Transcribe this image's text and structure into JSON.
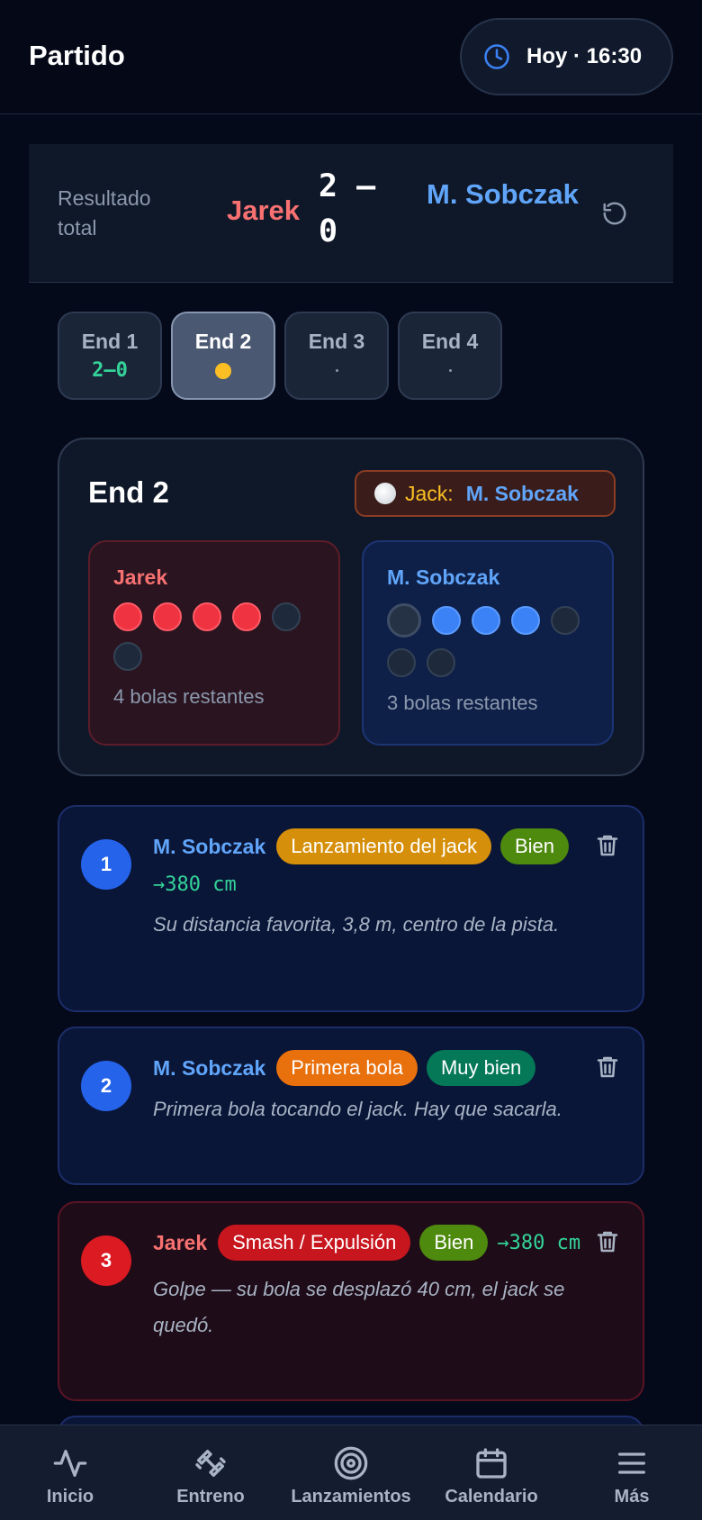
{
  "header": {
    "title": "Partido",
    "time": "Hoy · 16:30",
    "time_icon": "clock-icon"
  },
  "score": {
    "label": "Resultado total",
    "player_a": "Jarek",
    "value": "2 — 0",
    "player_b": "M. Sobczak",
    "reset_icon": "reset-icon"
  },
  "ends": [
    {
      "label": "End 1",
      "sub": "2–0",
      "state": "done"
    },
    {
      "label": "End 2",
      "sub": "",
      "state": "active"
    },
    {
      "label": "End 3",
      "sub": "",
      "state": "pending"
    },
    {
      "label": "End 4",
      "sub": "",
      "state": "pending"
    }
  ],
  "end_panel": {
    "title": "End 2",
    "jack_label": "Jack:",
    "jack_player": "M. Sobczak",
    "players": [
      {
        "name": "Jarek",
        "remaining_text": "4 bolas restantes",
        "balls_remaining": 4,
        "balls_total": 6
      },
      {
        "name": "M. Sobczak",
        "remaining_text": "3 bolas restantes",
        "balls_remaining": 3,
        "balls_total": 6
      }
    ]
  },
  "events": [
    {
      "num": "1",
      "player": "M. Sobczak",
      "type": "Lanzamiento del jack",
      "rating": "Bien",
      "distance": "→380 cm",
      "note": "Su distancia favorita, 3,8 m, centro de la pista."
    },
    {
      "num": "2",
      "player": "M. Sobczak",
      "type": "Primera bola",
      "rating": "Muy bien",
      "distance": "",
      "note": "Primera bola tocando el jack. Hay que sacarla."
    },
    {
      "num": "3",
      "player": "Jarek",
      "type": "Smash / Expulsión",
      "rating": "Bien",
      "distance": "→380 cm",
      "note": "Golpe — su bola se desplazó 40 cm, el jack se quedó."
    }
  ],
  "nav": [
    {
      "label": "Inicio",
      "icon": "activity-icon"
    },
    {
      "label": "Entreno",
      "icon": "dumbbell-icon"
    },
    {
      "label": "Lanzamientos",
      "icon": "target-icon"
    },
    {
      "label": "Calendario",
      "icon": "calendar-icon"
    },
    {
      "label": "Más",
      "icon": "menu-icon"
    }
  ],
  "colors": {
    "background": "#050a1a",
    "player_a": "#f87171",
    "player_b": "#60a5fa",
    "accent_green": "#34d399",
    "jack_yellow": "#fbbf24"
  }
}
